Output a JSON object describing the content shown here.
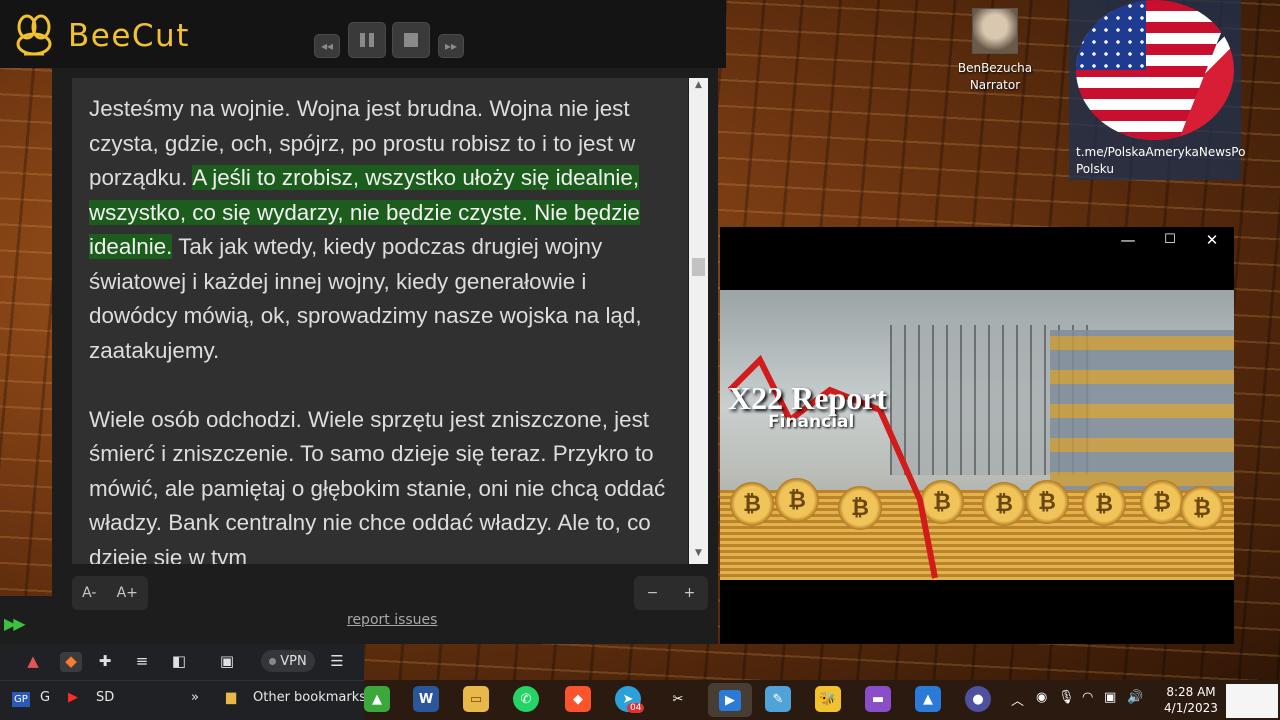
{
  "app": {
    "name": "BeeCut",
    "accent": "#f2c12e",
    "highlight_color": "#1c5c1c"
  },
  "player": {
    "prev_icon": "rewind-icon",
    "pause_icon": "pause-icon",
    "stop_icon": "stop-icon",
    "next_icon": "fast-forward-icon"
  },
  "reader": {
    "paragraph1_before": "Jesteśmy na wojnie. Wojna jest brudna. Wojna nie jest czysta, gdzie, och, spójrz, po prostu robisz to i to jest w porządku. ",
    "paragraph1_highlight": "A jeśli to zrobisz, wszystko ułoży się idealnie, wszystko, co się wydarzy, nie będzie czyste. Nie będzie idealnie.",
    "paragraph1_after": " Tak jak wtedy, kiedy podczas drugiej wojny światowej i każdej innej wojny, kiedy generałowie i dowódcy mówią, ok, sprowadzimy nasze wojska na ląd, zaatakujemy.",
    "paragraph2": "Wiele osób odchodzi. Wiele sprzętu jest zniszczone, jest śmierć i zniszczenie. To samo dzieje się teraz. Przykro to mówić, ale pamiętaj o głębokim stanie, oni nie chcą oddać władzy. Bank centralny nie chce oddać władzy. Ale to, co dzieje się w tym"
  },
  "controls": {
    "font_smaller": "A-",
    "font_larger": "A+",
    "speed_minus": "−",
    "speed_plus": "+",
    "report_link": "report issues"
  },
  "desktop": {
    "narrator_label": "BenBezucha Narrator",
    "telegram_label": "t.me/PolskaAmerykaNewsPo Polsku"
  },
  "video": {
    "logo_text": "X22 Report",
    "sub_text": "Financial",
    "minimize_icon": "minimize-icon",
    "maximize_icon": "maximize-icon",
    "close_icon": "close-icon"
  },
  "browser": {
    "vpn_label": "VPN",
    "bookmarks": [
      "G",
      "SD",
      "»",
      "Other bookmarks"
    ]
  },
  "taskbar": {
    "time": "8:28 AM",
    "date": "4/1/2023",
    "badge": "04"
  }
}
